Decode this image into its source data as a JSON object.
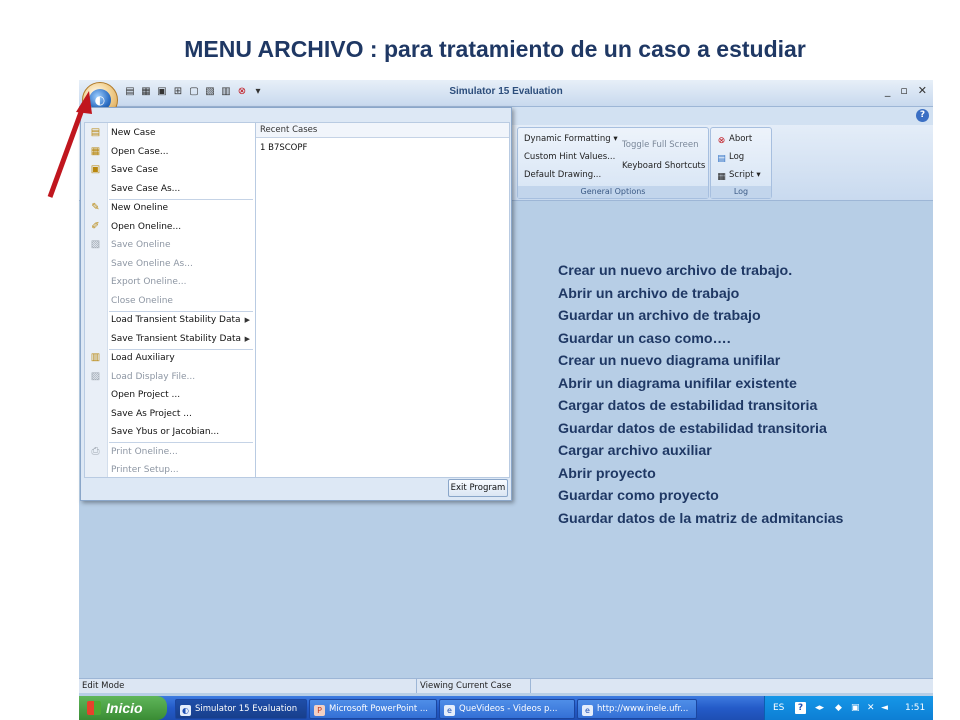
{
  "slide": {
    "title": "MENU ARCHIVO : para  tratamiento de un caso a estudiar"
  },
  "window": {
    "title": "Simulator 15 Evaluation",
    "minimize": "_",
    "restore": "▫",
    "close": "✕"
  },
  "qat_icons": [
    "new-case-icon",
    "open-oneline-icon",
    "save-icon",
    "grid-icon",
    "page-icon",
    "tool-icon",
    "table-icon",
    "close-circle-icon",
    "dropdown-icon"
  ],
  "ribbon": {
    "options_group": {
      "label": "General Options",
      "dynamic_formatting": "Dynamic Formatting",
      "custom_hint_values": "Custom Hint Values...",
      "default_drawing": "Default Drawing...",
      "toggle_full_screen": "Toggle Full Screen",
      "keyboard_shortcuts": "Keyboard Shortcuts"
    },
    "log_group": {
      "label": "Log",
      "abort": "Abort",
      "log": "Log",
      "script": "Script"
    }
  },
  "menu": {
    "items": [
      {
        "label": "New Case",
        "icon": "new-case-icon",
        "enabled": true
      },
      {
        "label": "Open Case...",
        "icon": "open-case-icon",
        "enabled": true
      },
      {
        "label": "Save Case",
        "icon": "save-case-icon",
        "enabled": true
      },
      {
        "label": "Save Case As...",
        "icon": "",
        "enabled": true
      },
      {
        "label": "New Oneline",
        "icon": "new-oneline-icon",
        "enabled": true
      },
      {
        "label": "Open Oneline...",
        "icon": "open-oneline-icon",
        "enabled": true
      },
      {
        "label": "Save Oneline",
        "icon": "save-oneline-icon",
        "enabled": false
      },
      {
        "label": "Save Oneline As...",
        "icon": "",
        "enabled": false
      },
      {
        "label": "Export Oneline...",
        "icon": "",
        "enabled": false
      },
      {
        "label": "Close Oneline",
        "icon": "",
        "enabled": false
      },
      {
        "label": "Load Transient Stability Data",
        "icon": "",
        "enabled": true,
        "submenu": true
      },
      {
        "label": "Save Transient Stability Data",
        "icon": "",
        "enabled": true,
        "submenu": true
      },
      {
        "label": "Load Auxiliary",
        "icon": "auxiliary-icon",
        "enabled": true
      },
      {
        "label": "Load Display File...",
        "icon": "display-file-icon",
        "enabled": false
      },
      {
        "label": "Open Project ...",
        "icon": "",
        "enabled": true
      },
      {
        "label": "Save As Project ...",
        "icon": "",
        "enabled": true
      },
      {
        "label": "Save Ybus or Jacobian...",
        "icon": "",
        "enabled": true
      },
      {
        "label": "Print Oneline...",
        "icon": "printer-icon",
        "enabled": false
      },
      {
        "label": "Printer Setup...",
        "icon": "",
        "enabled": false
      }
    ],
    "recent_header": "Recent Cases",
    "recent_items": [
      "1 B7SCOPF"
    ],
    "exit_label": "Exit Program"
  },
  "descriptions": [
    "Crear un nuevo archivo de trabajo.",
    "Abrir  un archivo de trabajo",
    "Guardar  un archivo de trabajo",
    "Guardar un caso como….",
    "Crear un nuevo diagrama unifilar",
    "Abrir un diagrama unifilar existente",
    "Cargar datos de estabilidad transitoria",
    "Guardar datos de estabilidad transitoria",
    "Cargar archivo auxiliar",
    "Abrir proyecto",
    "Guardar como proyecto",
    "Guardar datos de la matriz de admitancias"
  ],
  "status": {
    "mode": "Edit Mode",
    "viewing": "Viewing Current Case"
  },
  "taskbar": {
    "start": "Inicio",
    "tasks": [
      {
        "label": "Simulator 15 Evaluation",
        "active": true
      },
      {
        "label": "Microsoft PowerPoint ...",
        "active": false
      },
      {
        "label": "QueVideos - Videos p...",
        "active": false
      },
      {
        "label": "http://www.inele.ufr...",
        "active": false
      }
    ],
    "lang": "ES",
    "clock": "1:51"
  },
  "colors": {
    "title": "#1f3864",
    "annotation_arrow": "#c0161e",
    "app_background": "#b7cee6"
  }
}
